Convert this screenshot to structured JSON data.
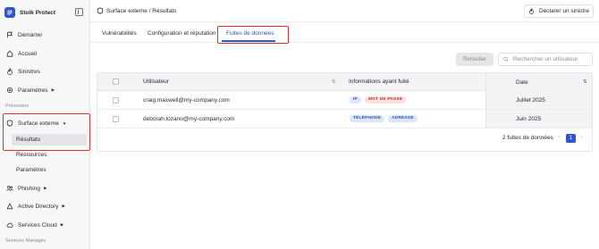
{
  "brand": {
    "name": "Stoïk Protect"
  },
  "sidebar": {
    "items": [
      {
        "label": "Démarrer",
        "icon": "flag-icon"
      },
      {
        "label": "Accueil",
        "icon": "home-icon"
      },
      {
        "label": "Sinistres",
        "icon": "flame-icon"
      },
      {
        "label": "Paramètres",
        "icon": "gear-icon"
      }
    ],
    "section_prevention": "Prévention",
    "surface": {
      "label": "Surface externe",
      "sub": [
        "Résultats",
        "Ressources",
        "Paramètres"
      ]
    },
    "phishing": "Phishing",
    "active_directory": "Active Directory",
    "services_cloud": "Services Cloud",
    "section_managed": "Services Managés"
  },
  "header": {
    "breadcrumb": "Surface externe / Résultats",
    "declare_label": "Déclarer un sinistre"
  },
  "tabs": [
    "Vulnérabilités",
    "Configuration et réputation",
    "Fuites de données"
  ],
  "toolbar": {
    "remove_label": "Remédier",
    "search_placeholder": "Rechercher un utilisateur"
  },
  "table": {
    "columns": [
      "Utilisateur",
      "Informations ayant fuité",
      "Date"
    ],
    "rows": [
      {
        "user": "craig.maxwell@my-company.com",
        "tags": [
          [
            "IP",
            "blue"
          ],
          [
            "MOT DE PASSE",
            "red"
          ]
        ],
        "date": "Juillet 2025"
      },
      {
        "user": "deborah.lozano@my-company.com",
        "tags": [
          [
            "TÉLÉPHONE",
            "blue"
          ],
          [
            "ADRESSE",
            "blue"
          ]
        ],
        "date": "Juin 2025"
      }
    ],
    "count": "2 fuites de données",
    "page": "1"
  },
  "colors": {
    "accent": "#2f55d4",
    "highlight": "#e0322b"
  }
}
